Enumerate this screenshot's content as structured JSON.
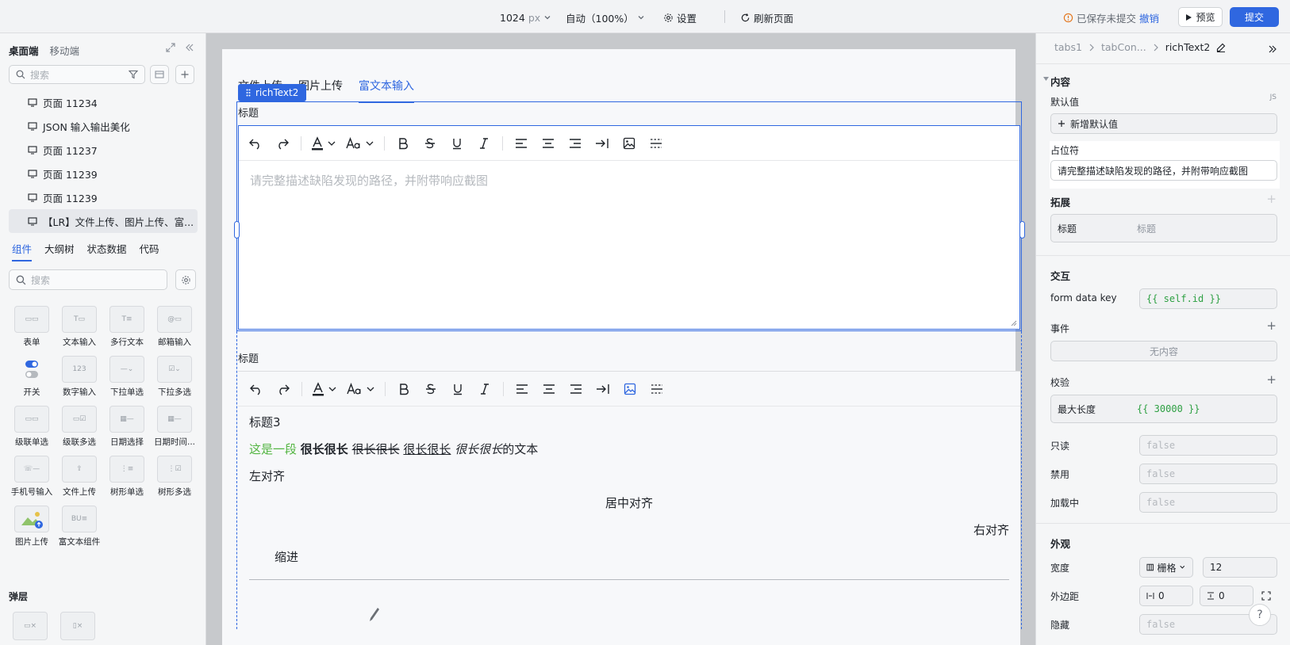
{
  "topbar": {
    "width_value": "1024",
    "width_unit": "px",
    "zoom": "自动（100%）",
    "settings": "设置",
    "refresh": "刷新页面",
    "save_status": "已保存未提交",
    "undo": "撤销",
    "preview": "预览",
    "submit": "提交"
  },
  "left": {
    "tabs": [
      "桌面端",
      "移动端"
    ],
    "search_placeholder": "搜索",
    "pages": [
      "页面 11234",
      "JSON 输入输出美化",
      "页面 11237",
      "页面 11239",
      "页面 11239",
      "【LR】文件上传、图片上传、富..."
    ],
    "panel_tabs": [
      "组件",
      "大纲树",
      "状态数据",
      "代码"
    ],
    "component_search_placeholder": "搜索",
    "components": [
      "表单",
      "文本输入",
      "多行文本",
      "邮箱输入",
      "开关",
      "数字输入",
      "下拉单选",
      "下拉多选",
      "级联单选",
      "级联多选",
      "日期选择",
      "日期时间...",
      "手机号输入",
      "文件上传",
      "树形单选",
      "树形多选",
      "图片上传",
      "富文本组件"
    ],
    "layer_section": "弹层"
  },
  "canvas": {
    "tabs": [
      "文件上传",
      "图片上传",
      "富文本输入"
    ],
    "selected_tag": "richText2",
    "field1_label": "标题",
    "editor1_placeholder": "请完整描述缺陷发现的路径，并附带响应截图",
    "field2_label": "标题",
    "editor2": {
      "heading": "标题3",
      "line_part1": "这是一段",
      "line_bold": "很长很长",
      "line_strike": "很长很长",
      "line_underline": "很长很长",
      "line_italic": "很长很长",
      "line_tail": "的文本",
      "left_align": "左对齐",
      "center_align": "居中对齐",
      "right_align": "右对齐",
      "indent": "缩进"
    }
  },
  "right": {
    "breadcrumbs": [
      "tabs1",
      "tabCon...",
      "richText2"
    ],
    "content_section": "内容",
    "default_value_label": "默认值",
    "js_badge": "JS",
    "add_default": "新增默认值",
    "placeholder_label": "占位符",
    "placeholder_value": "请完整描述缺陷发现的路径，并附带响应截图",
    "extend_section": "拓展",
    "extend_title_label": "标题",
    "extend_title_value": "标题",
    "interaction_section": "交互",
    "form_key_label": "form data key",
    "form_key_value": "{{ self.id }}",
    "events_label": "事件",
    "events_empty": "无内容",
    "validation_label": "校验",
    "max_length_label": "最大长度",
    "max_length_value": "{{ 30000 }}",
    "readonly_label": "只读",
    "readonly_value": "false",
    "disabled_label": "禁用",
    "disabled_value": "false",
    "loading_label": "加载中",
    "loading_value": "false",
    "appearance_section": "外观",
    "width_label": "宽度",
    "width_mode": "栅格",
    "width_value": "12",
    "margin_label": "外边距",
    "margin_h": "0",
    "margin_v": "0",
    "hidden_label": "隐藏",
    "hidden_value": "false"
  },
  "colors": {
    "accent": "#2f67e0",
    "code_green": "#2ea043",
    "warn": "#e37318"
  }
}
